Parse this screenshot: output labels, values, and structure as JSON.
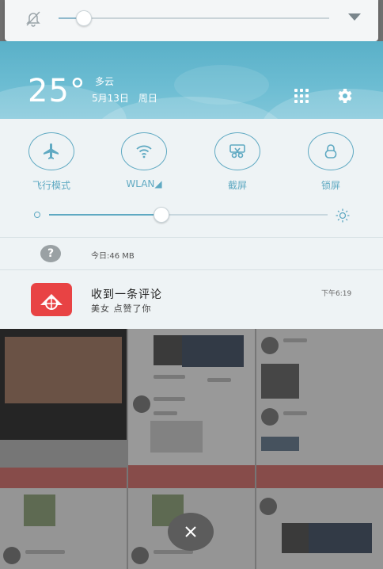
{
  "volume": {
    "level": 0.09,
    "icon": "bell-off-icon",
    "expand_icon": "chevron-down-icon"
  },
  "weather": {
    "temperature": "25°",
    "condition": "多云",
    "date": "5月13日",
    "weekday": "周日"
  },
  "quick_settings": {
    "tiles": [
      {
        "label": "飞行模式",
        "icon": "airplane-icon"
      },
      {
        "label": "WLAN◢",
        "icon": "wifi-icon"
      },
      {
        "label": "截屏",
        "icon": "scissors-icon"
      },
      {
        "label": "锁屏",
        "icon": "lock-icon"
      }
    ],
    "brightness": 0.4,
    "traffic": {
      "label": "今日:46 MB",
      "icon": "question-icon"
    }
  },
  "notification": {
    "title": "收到一条评论",
    "message": "美女 点赞了你",
    "time": "下午6:19",
    "icon": "app-icon"
  },
  "colors": {
    "accent": "#5fa9c2",
    "weather_bg": "#6bbcd2",
    "app_red": "#e84344"
  }
}
